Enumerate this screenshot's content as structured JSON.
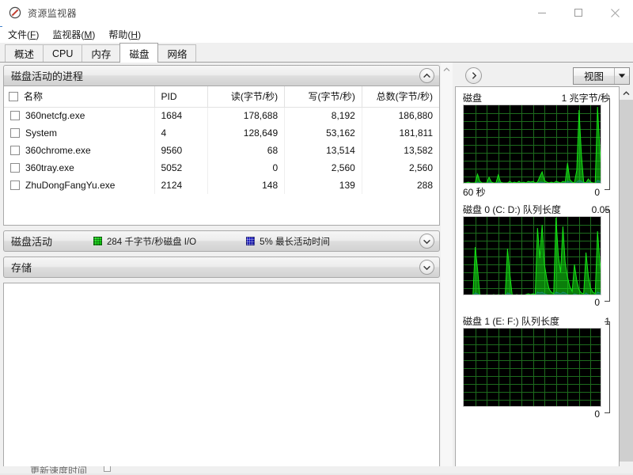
{
  "window": {
    "title": "资源监视器",
    "icon": "resource-monitor-icon",
    "minimize_label": "最小化",
    "maximize_label": "最大化",
    "close_label": "关闭"
  },
  "menu": {
    "items": [
      {
        "label": "文件",
        "accel": "F"
      },
      {
        "label": "监视器",
        "accel": "M"
      },
      {
        "label": "帮助",
        "accel": "H"
      }
    ]
  },
  "tabs": [
    {
      "label": "概述",
      "active": false
    },
    {
      "label": "CPU",
      "active": false
    },
    {
      "label": "内存",
      "active": false
    },
    {
      "label": "磁盘",
      "active": true
    },
    {
      "label": "网络",
      "active": false
    }
  ],
  "processes_section": {
    "title": "磁盘活动的进程",
    "expanded": true,
    "chevron": "chevron-up-icon",
    "columns": [
      "名称",
      "PID",
      "读(字节/秒)",
      "写(字节/秒)",
      "总数(字节/秒)"
    ],
    "sorted_column_index": 4,
    "sort_direction": "descending",
    "rows": [
      {
        "name": "360netcfg.exe",
        "pid": "1684",
        "read": "178,688",
        "write": "8,192",
        "total": "186,880",
        "checked": false
      },
      {
        "name": "System",
        "pid": "4",
        "read": "128,649",
        "write": "53,162",
        "total": "181,811",
        "checked": false
      },
      {
        "name": "360chrome.exe",
        "pid": "9560",
        "read": "68",
        "write": "13,514",
        "total": "13,582",
        "checked": false
      },
      {
        "name": "360tray.exe",
        "pid": "5052",
        "read": "0",
        "write": "2,560",
        "total": "2,560",
        "checked": false
      },
      {
        "name": "ZhuDongFangYu.exe",
        "pid": "2124",
        "read": "148",
        "write": "139",
        "total": "288",
        "checked": false
      }
    ]
  },
  "disk_activity_section": {
    "title": "磁盘活动",
    "expanded": false,
    "chevron": "chevron-down-icon",
    "legend": [
      {
        "swatch": "green",
        "color": "#14d614",
        "text": "284 千字节/秒磁盘 I/O"
      },
      {
        "swatch": "blue",
        "color": "#1414c8",
        "text": "5% 最长活动时间"
      }
    ]
  },
  "storage_section": {
    "title": "存储",
    "expanded": false,
    "chevron": "chevron-down-icon"
  },
  "graph_panel": {
    "collapse_button": "chevron-right-icon",
    "view_button": {
      "label": "视图",
      "arrow": "chevron-down-icon"
    }
  },
  "status_bar": {
    "text": "更新速度时间"
  },
  "chart_data": [
    {
      "type": "area",
      "name": "disk-throughput-graph",
      "title": "磁盘",
      "ymax_label": "1 兆字节/秒",
      "ymin_label": "0",
      "xaxis_label": "60 秒",
      "ylim": [
        0,
        1
      ],
      "xlim": [
        0,
        60
      ],
      "grid": true,
      "grid_cols": 12,
      "grid_rows": 10,
      "background": "#000000",
      "grid_color": "#1d6b1d",
      "series": [
        {
          "name": "磁盘 I/O",
          "color": "#14e614",
          "values": [
            0.02,
            0.02,
            0.03,
            0.02,
            0.02,
            0.02,
            0.13,
            0.04,
            0.02,
            0.02,
            0.02,
            0.09,
            0.03,
            0.02,
            0.02,
            0.12,
            0.03,
            0.02,
            0.02,
            0.02,
            0.04,
            0.02,
            0.03,
            0.02,
            0.04,
            0.02,
            0.03,
            0.02,
            0.04,
            0.03,
            0.04,
            0.02,
            0.03,
            0.1,
            0.16,
            0.05,
            0.03,
            0.02,
            0.03,
            0.02,
            0.04,
            0.03,
            0.02,
            0.04,
            0.03,
            0.27,
            0.06,
            0.03,
            0.02,
            0.18,
            0.94,
            0.38,
            0.03,
            0.02,
            0.07,
            0.03,
            0.02,
            0.02,
            0.98,
            0.45,
            0.08
          ]
        },
        {
          "name": "最长活动时间",
          "color": "#2020e0",
          "values": [
            0.01,
            0.01,
            0.02,
            0.01,
            0.01,
            0.01,
            0.03,
            0.02,
            0.01,
            0.01,
            0.01,
            0.03,
            0.02,
            0.01,
            0.01,
            0.03,
            0.02,
            0.01,
            0.01,
            0.01,
            0.02,
            0.01,
            0.02,
            0.01,
            0.02,
            0.01,
            0.02,
            0.01,
            0.02,
            0.02,
            0.02,
            0.01,
            0.02,
            0.03,
            0.03,
            0.02,
            0.01,
            0.01,
            0.02,
            0.01,
            0.02,
            0.02,
            0.01,
            0.02,
            0.02,
            0.04,
            0.03,
            0.02,
            0.01,
            0.03,
            0.05,
            0.04,
            0.02,
            0.01,
            0.03,
            0.02,
            0.01,
            0.01,
            0.05,
            0.04,
            0.03
          ]
        }
      ]
    },
    {
      "type": "area",
      "name": "disk0-queue-length-graph",
      "title": "磁盘 0 (C: D:) 队列长度",
      "ymax_label": "0.05",
      "ymin_label": "0",
      "xaxis_label": "",
      "ylim": [
        0,
        0.05
      ],
      "xlim": [
        0,
        60
      ],
      "grid": true,
      "grid_cols": 12,
      "grid_rows": 10,
      "background": "#000000",
      "grid_color": "#1d6b1d",
      "series": [
        {
          "name": "队列长度",
          "color": "#14e614",
          "values": [
            0.0,
            0.0,
            0.0,
            0.0,
            0.0,
            0.62,
            0.35,
            0.02,
            0.01,
            0.01,
            0.02,
            0.01,
            0.01,
            0.02,
            0.01,
            0.02,
            0.01,
            0.02,
            0.01,
            0.6,
            0.28,
            0.02,
            0.01,
            0.02,
            0.01,
            0.02,
            0.01,
            0.02,
            0.03,
            0.02,
            0.03,
            0.02,
            0.86,
            0.48,
            0.9,
            0.4,
            0.22,
            0.09,
            0.05,
            0.03,
            0.99,
            0.52,
            0.3,
            0.88,
            0.42,
            0.24,
            0.12,
            0.06,
            0.4,
            0.2,
            0.08,
            0.04,
            0.03,
            0.55,
            0.26,
            0.1,
            0.05,
            0.03,
            0.82,
            0.44,
            0.18
          ]
        },
        {
          "name": "活动时间",
          "color": "#2020e0",
          "values": [
            0.0,
            0.0,
            0.0,
            0.0,
            0.0,
            0.04,
            0.03,
            0.01,
            0.01,
            0.01,
            0.01,
            0.01,
            0.01,
            0.01,
            0.01,
            0.01,
            0.01,
            0.01,
            0.01,
            0.04,
            0.03,
            0.01,
            0.01,
            0.01,
            0.01,
            0.01,
            0.01,
            0.01,
            0.02,
            0.01,
            0.02,
            0.01,
            0.05,
            0.04,
            0.05,
            0.03,
            0.02,
            0.01,
            0.01,
            0.01,
            0.05,
            0.04,
            0.03,
            0.05,
            0.04,
            0.02,
            0.01,
            0.01,
            0.03,
            0.02,
            0.01,
            0.01,
            0.01,
            0.04,
            0.02,
            0.01,
            0.01,
            0.01,
            0.05,
            0.04,
            0.02
          ]
        }
      ]
    },
    {
      "type": "area",
      "name": "disk1-queue-length-graph",
      "title": "磁盘 1 (E: F:) 队列长度",
      "ymax_label": "1",
      "ymin_label": "0",
      "xaxis_label": "",
      "ylim": [
        0,
        1
      ],
      "xlim": [
        0,
        60
      ],
      "grid": true,
      "grid_cols": 12,
      "grid_rows": 10,
      "background": "#000000",
      "grid_color": "#1d6b1d",
      "series": [
        {
          "name": "队列长度",
          "color": "#14e614",
          "values": [
            0,
            0,
            0,
            0,
            0,
            0,
            0,
            0,
            0,
            0,
            0,
            0,
            0,
            0,
            0,
            0,
            0,
            0,
            0,
            0,
            0,
            0,
            0,
            0,
            0,
            0,
            0,
            0,
            0,
            0,
            0,
            0,
            0,
            0,
            0,
            0,
            0,
            0,
            0,
            0,
            0,
            0,
            0,
            0,
            0,
            0,
            0,
            0,
            0,
            0,
            0,
            0,
            0,
            0,
            0,
            0,
            0,
            0,
            0,
            0,
            0
          ]
        }
      ]
    }
  ]
}
